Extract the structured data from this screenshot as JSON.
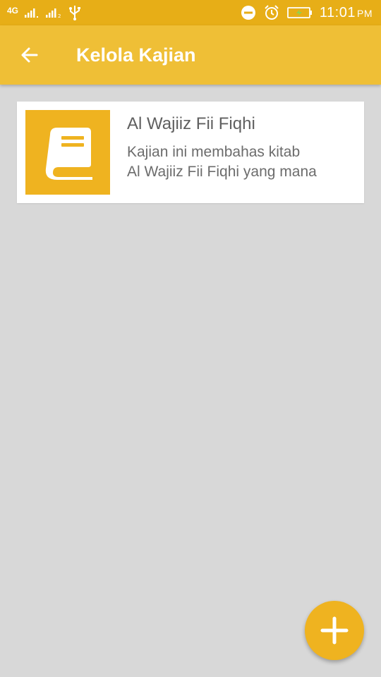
{
  "status_bar": {
    "network": "4G",
    "time": "11:01",
    "ampm": "PM",
    "icons": [
      "signal-bars-icon",
      "signal-bars-2-icon",
      "usb-icon",
      "do-not-disturb-icon",
      "alarm-clock-icon",
      "battery-charging-icon"
    ]
  },
  "app_bar": {
    "title": "Kelola Kajian",
    "back_icon": "arrow-left-icon",
    "color": "#efbf36"
  },
  "kajian_list": [
    {
      "title": "Al Wajiiz Fii Fiqhi",
      "description_line1": "Kajian ini membahas kitab",
      "description_line2": "Al Wajiiz Fii Fiqhi yang mana",
      "icon": "book-icon"
    }
  ],
  "fab": {
    "icon": "plus-icon",
    "color": "#efb320"
  },
  "colors": {
    "status_bar": "#e7ae17",
    "accent": "#efb320",
    "background": "#d8d8d8"
  }
}
